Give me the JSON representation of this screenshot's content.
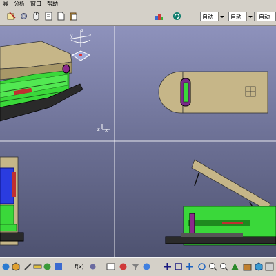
{
  "menu": {
    "items": [
      {
        "label": "具"
      },
      {
        "label": "分析"
      },
      {
        "label": "窗口"
      },
      {
        "label": "帮助"
      }
    ]
  },
  "toolbar": {
    "icons": [
      "sketch-icon",
      "gear-icon",
      "mouse-icon",
      "doc-icon",
      "new-icon",
      "paste-icon",
      "analysis-icon",
      "refresh-icon"
    ],
    "combos": [
      {
        "value": "自动"
      },
      {
        "value": "自动"
      },
      {
        "value": "自动"
      },
      {
        "value": "自动"
      }
    ]
  },
  "viewport": {
    "background_top": "#8e92bc",
    "background_bottom": "#4e5270",
    "compass_axis_labels": {
      "z": "z",
      "x": "x",
      "y": "y"
    },
    "triad_labels": {
      "x": "x",
      "z": "z"
    }
  },
  "colors": {
    "tan": "#b8a878",
    "green": "#3cd23c",
    "blue": "#2a3ce0",
    "dark_plate": "#2a2a2a",
    "magenta": "#8a2a8a"
  },
  "bottom_toolbar": {
    "left_text": "f(x)",
    "icons": [
      "select-icon",
      "cube-icon",
      "sketch-icon",
      "measure-icon",
      "grid-icon",
      "tree-icon",
      "tree2-icon",
      "table-icon",
      "render-icon",
      "filter-icon",
      "sphere-icon",
      "mirror-icon",
      "move-icon",
      "rotate-icon",
      "fit-icon",
      "pan-icon",
      "rotate3d-icon",
      "zoom-in-icon",
      "zoom-out-icon",
      "normal-view-icon",
      "views-icon",
      "shading-icon",
      "hide-icon",
      "swap-icon"
    ]
  }
}
